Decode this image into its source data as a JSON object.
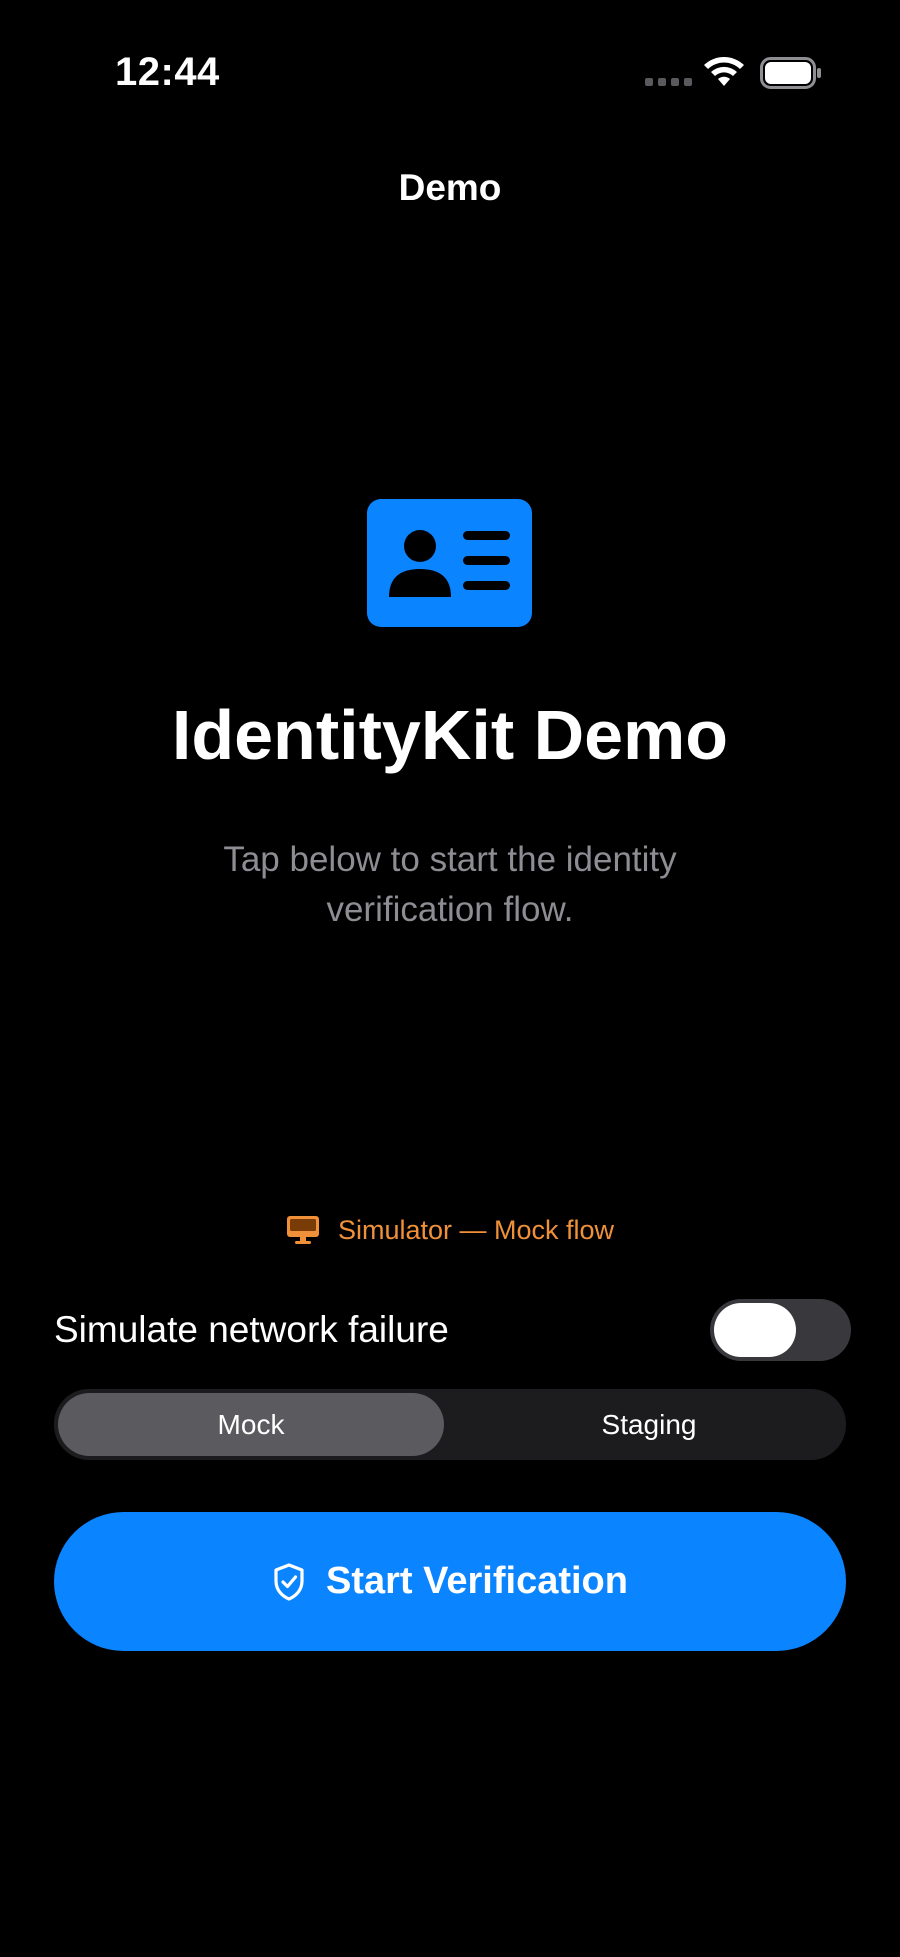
{
  "status_bar": {
    "time": "12:44",
    "icons": [
      "cellular-signal-icon",
      "wifi-icon",
      "battery-icon"
    ]
  },
  "nav": {
    "title": "Demo"
  },
  "hero": {
    "icon": "id-card-icon",
    "title": "IdentityKit Demo",
    "subtitle": "Tap below to start the identity verification flow."
  },
  "environment": {
    "icon": "desktop-computer-icon",
    "label": "Simulator — Mock flow"
  },
  "network_failure": {
    "label": "Simulate network failure",
    "enabled": false
  },
  "mode_selector": {
    "options": [
      "Mock",
      "Staging"
    ],
    "selected": "Mock"
  },
  "primary_action": {
    "icon": "shield-check-icon",
    "label": "Start Verification"
  },
  "colors": {
    "background": "#000000",
    "accent": "#0a84ff",
    "warning": "#f0913a",
    "secondary_text": "#8d8d93"
  }
}
